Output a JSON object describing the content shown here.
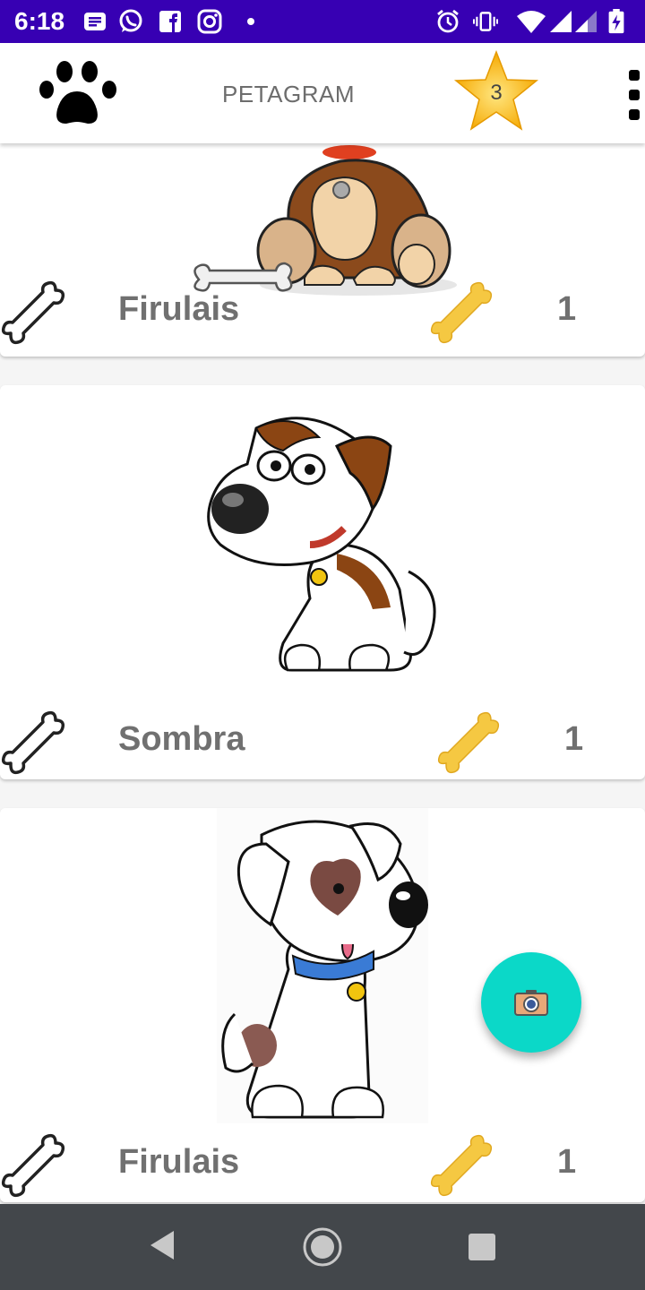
{
  "status_bar": {
    "time": "6:18",
    "left_icons": [
      "notes-icon",
      "whatsapp-icon",
      "facebook-icon",
      "instagram-icon",
      "dot-icon"
    ],
    "right_icons": [
      "alarm-icon",
      "vibrate-icon",
      "wifi-icon",
      "signal-icon",
      "signal-icon",
      "battery-charging-icon"
    ]
  },
  "app_bar": {
    "title": "PETAGRAM",
    "favorites_count": "3",
    "logo_icon": "paw-icon",
    "favorites_icon": "star-icon",
    "menu_icon": "overflow-menu-icon"
  },
  "pets": [
    {
      "name": "Firulais",
      "likes": "1",
      "image": "brown-puppy-with-bone"
    },
    {
      "name": "Sombra",
      "likes": "1",
      "image": "white-brown-puppy-red-collar"
    },
    {
      "name": "Firulais",
      "likes": "1",
      "image": "white-puppy-blue-collar"
    }
  ],
  "fab": {
    "icon": "camera-icon"
  },
  "nav_bar": {
    "icons": [
      "back-icon",
      "home-icon",
      "recents-icon"
    ]
  },
  "colors": {
    "status_bar": "#3700b3",
    "fab": "#0bd8c8",
    "star": "#ffc107",
    "gold_bone": "#f5c842",
    "nav_bar": "#43474b"
  }
}
